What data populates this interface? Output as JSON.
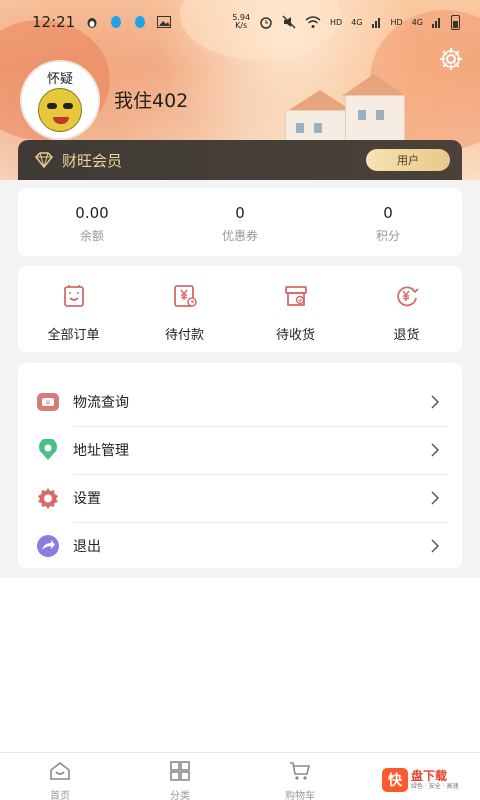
{
  "status_bar": {
    "time": "12:21",
    "speed_value": "5.94",
    "speed_unit": "K/s",
    "hd1": "HD",
    "net1": "4G",
    "hd2": "HD",
    "net2": "4G"
  },
  "profile": {
    "avatar_text": "怀疑",
    "username": "我住402"
  },
  "member": {
    "label": "财旺会员",
    "badge": "用户"
  },
  "stats": [
    {
      "value": "0.00",
      "label": "余额"
    },
    {
      "value": "0",
      "label": "优惠券"
    },
    {
      "value": "0",
      "label": "积分"
    }
  ],
  "orders": [
    {
      "label": "全部订单",
      "icon": "order-list-icon"
    },
    {
      "label": "待付款",
      "icon": "wallet-yen-icon"
    },
    {
      "label": "待收货",
      "icon": "package-check-icon"
    },
    {
      "label": "退货",
      "icon": "refund-yen-icon"
    }
  ],
  "menu": [
    {
      "label": "物流查询",
      "icon": "logistics-icon",
      "color": "#d77a7a"
    },
    {
      "label": "地址管理",
      "icon": "location-pin-icon",
      "color": "#4bbd86"
    },
    {
      "label": "设置",
      "icon": "gear-icon",
      "color": "#d46a6a"
    },
    {
      "label": "退出",
      "icon": "logout-icon",
      "color": "#8a7de0"
    }
  ],
  "bottom_nav": [
    {
      "label": "首页",
      "icon": "home-icon"
    },
    {
      "label": "分类",
      "icon": "grid-icon"
    },
    {
      "label": "购物车",
      "icon": "cart-icon"
    }
  ],
  "watermark": {
    "badge": "快",
    "title": "盘下载",
    "subtitle": "绿色 · 安全 · 高速"
  }
}
